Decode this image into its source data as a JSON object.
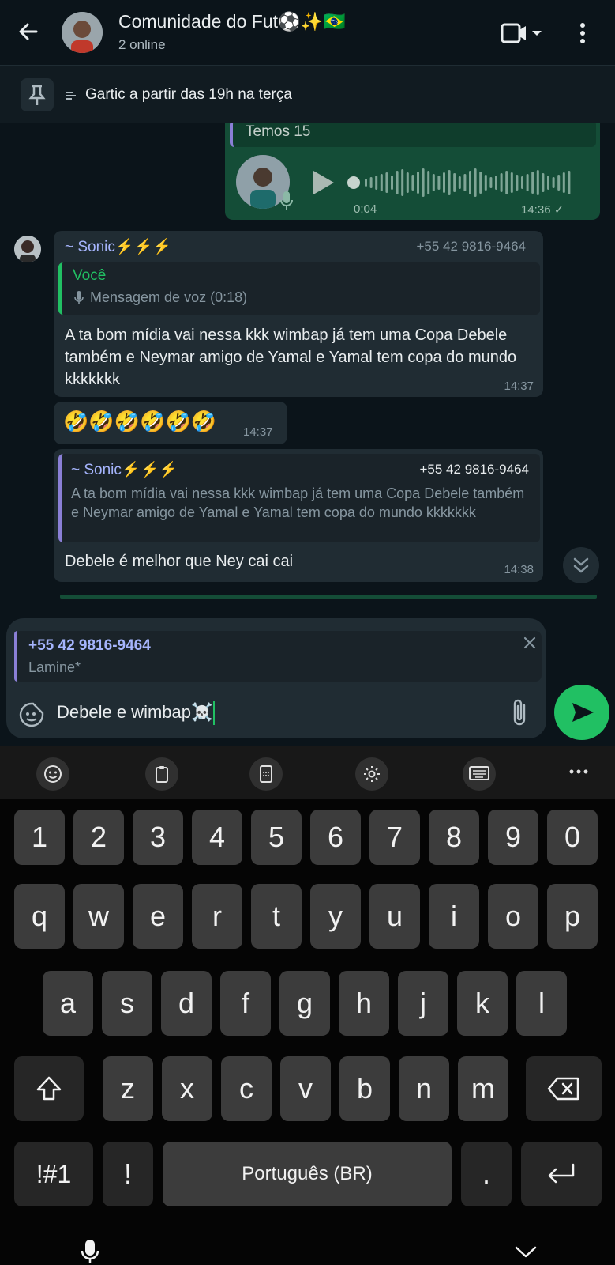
{
  "header": {
    "title": "Comunidade do Fut⚽✨🇧🇷",
    "subtitle": "2 online"
  },
  "pinned": {
    "text": "Gartic a partir das 19h na terça"
  },
  "messages": {
    "voice_out": {
      "quote_text": "Temos 15",
      "duration": "0:04",
      "time": "14:36 ✓"
    },
    "sonic1": {
      "sender": "~ Sonic⚡⚡⚡",
      "phone": "+55 42 9816-9464",
      "quote_sender": "Você",
      "quote_text": "Mensagem de voz (0:18)",
      "text": "A ta bom mídia vai nessa kkk wimbap já tem uma Copa Debele também e Neymar amigo de Yamal e Yamal tem copa do mundo kkkkkkk",
      "time": "14:37"
    },
    "emoji_msg": {
      "text": "🤣🤣🤣🤣🤣🤣",
      "time": "14:37"
    },
    "sonic2": {
      "quote_sender": "~ Sonic⚡⚡⚡",
      "quote_phone": "+55 42 9816-9464",
      "quote_text": "A ta bom mídia vai nessa kkk wimbap já tem uma Copa Debele também e Neymar amigo de Yamal e Yamal tem copa do mundo kkkkkkk",
      "text": "Debele é melhor que Ney cai cai",
      "time": "14:38"
    }
  },
  "composer": {
    "reply_to_phone": "+55 42 9816-9464",
    "reply_to_text": "Lamine*",
    "input_value": "Debele e wimbap☠️"
  },
  "keyboard": {
    "row1": [
      "1",
      "2",
      "3",
      "4",
      "5",
      "6",
      "7",
      "8",
      "9",
      "0"
    ],
    "row2": [
      "q",
      "w",
      "e",
      "r",
      "t",
      "y",
      "u",
      "i",
      "o",
      "p"
    ],
    "row3": [
      "a",
      "s",
      "d",
      "f",
      "g",
      "h",
      "j",
      "k",
      "l"
    ],
    "row4": [
      "z",
      "x",
      "c",
      "v",
      "b",
      "n",
      "m"
    ],
    "symbols_label": "!#1",
    "exclaim_label": "!",
    "space_label": "Português (BR)",
    "period_label": "."
  },
  "colors": {
    "accent": "#21c063",
    "outgoing": "#144d37",
    "incoming": "#202c33",
    "sender": "#a5b4fc"
  }
}
